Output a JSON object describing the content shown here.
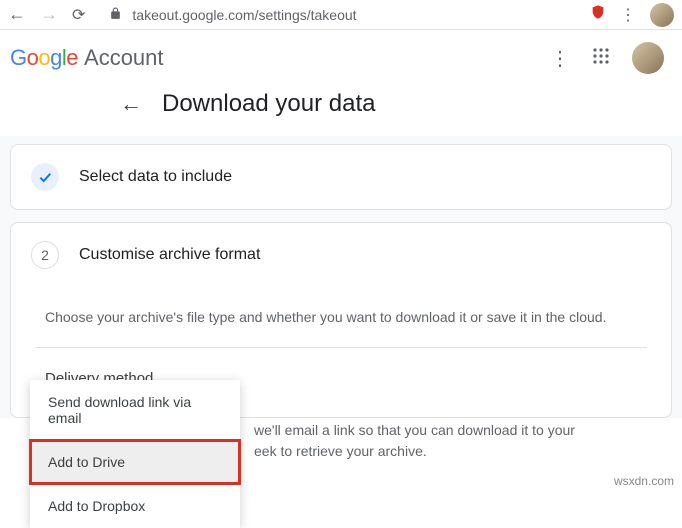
{
  "browser": {
    "url": "takeout.google.com/settings/takeout"
  },
  "header": {
    "logo_suffix": "Account",
    "page_title": "Download your data"
  },
  "steps": {
    "one": {
      "title": "Select data to include"
    },
    "two": {
      "number": "2",
      "title": "Customise archive format"
    }
  },
  "section": {
    "description": "Choose your archive's file type and whether you want to download it or save it in the cloud.",
    "delivery_label": "Delivery method",
    "explain_line1": "we'll email a link so that you can download it to your",
    "explain_line2": "eek to retrieve your archive."
  },
  "dropdown": {
    "items": [
      "Send download link via email",
      "Add to Drive",
      "Add to Dropbox"
    ]
  },
  "watermark": "wsxdn.com"
}
